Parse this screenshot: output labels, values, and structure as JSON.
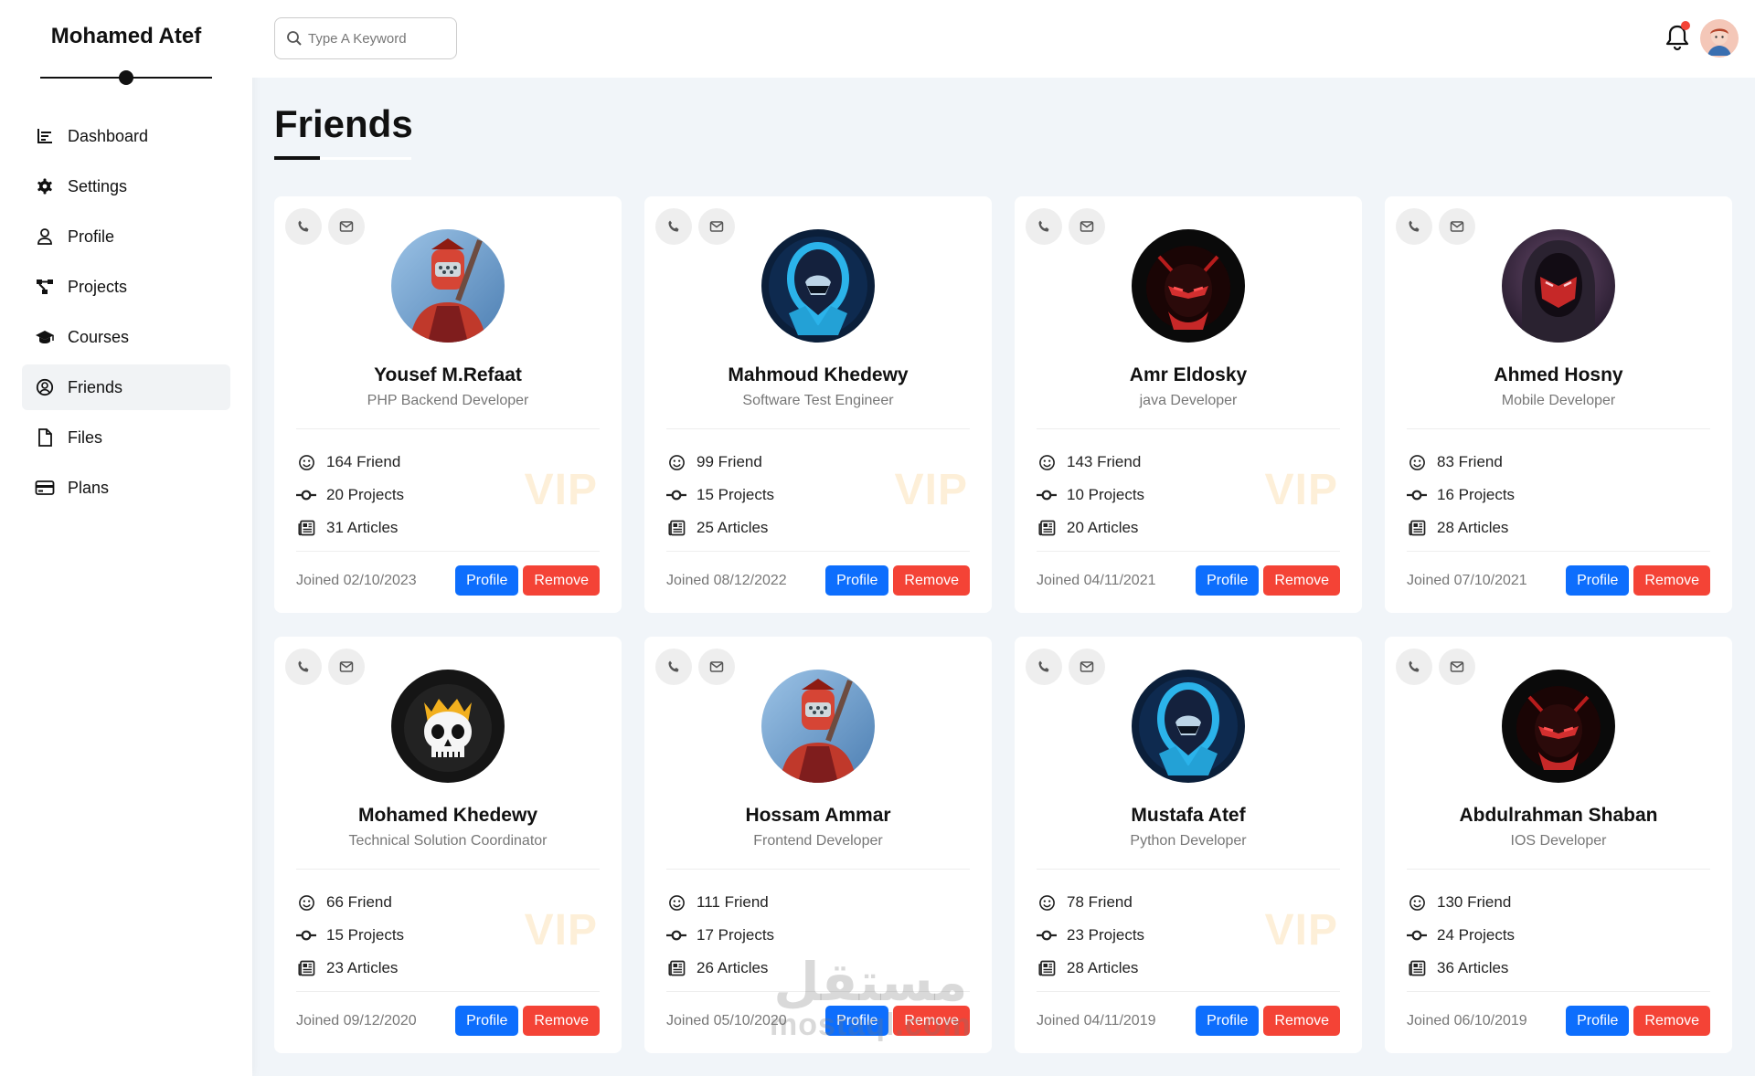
{
  "app": {
    "brand": "Mohamed Atef"
  },
  "sidebar": {
    "items": [
      {
        "label": "Dashboard",
        "icon": "chart-icon",
        "active": false
      },
      {
        "label": "Settings",
        "icon": "gear-icon",
        "active": false
      },
      {
        "label": "Profile",
        "icon": "user-icon",
        "active": false
      },
      {
        "label": "Projects",
        "icon": "project-diagram-icon",
        "active": false
      },
      {
        "label": "Courses",
        "icon": "graduation-cap-icon",
        "active": false
      },
      {
        "label": "Friends",
        "icon": "user-circle-icon",
        "active": true
      },
      {
        "label": "Files",
        "icon": "file-icon",
        "active": false
      },
      {
        "label": "Plans",
        "icon": "credit-card-icon",
        "active": false
      }
    ]
  },
  "header": {
    "search_placeholder": "Type A Keyword",
    "notification_badge_color": "#f44336"
  },
  "page": {
    "title": "Friends"
  },
  "labels": {
    "profile_button": "Profile",
    "remove_button": "Remove",
    "vip": "VIP"
  },
  "colors": {
    "primary": "#0d6efd",
    "danger": "#f44336",
    "vip": "#f59e0b"
  },
  "friends": [
    {
      "name": "Yousef M.Refaat",
      "role": "PHP Backend Developer",
      "friends": "164 Friend",
      "projects": "20 Projects",
      "articles": "31 Articles",
      "joined": "Joined 02/10/2023",
      "vip": true,
      "avatar": "red-armor-warrior"
    },
    {
      "name": "Mahmoud Khedewy",
      "role": "Software Test Engineer",
      "friends": "99 Friend",
      "projects": "15 Projects",
      "articles": "25 Articles",
      "joined": "Joined 08/12/2022",
      "vip": true,
      "avatar": "blue-hooded-assassin"
    },
    {
      "name": "Amr Eldosky",
      "role": "java Developer",
      "friends": "143 Friend",
      "projects": "10 Projects",
      "articles": "20 Articles",
      "joined": "Joined 04/11/2021",
      "vip": true,
      "avatar": "red-ninja"
    },
    {
      "name": "Ahmed Hosny",
      "role": "Mobile Developer",
      "friends": "83 Friend",
      "projects": "16 Projects",
      "articles": "28 Articles",
      "joined": "Joined 07/10/2021",
      "vip": false,
      "avatar": "red-masked-hood"
    },
    {
      "name": "Mohamed Khedewy",
      "role": "Technical Solution Coordinator",
      "friends": "66 Friend",
      "projects": "15 Projects",
      "articles": "23 Articles",
      "joined": "Joined 09/12/2020",
      "vip": true,
      "avatar": "crowned-skull"
    },
    {
      "name": "Hossam Ammar",
      "role": "Frontend Developer",
      "friends": "111 Friend",
      "projects": "17 Projects",
      "articles": "26 Articles",
      "joined": "Joined 05/10/2020",
      "vip": false,
      "avatar": "red-armor-warrior"
    },
    {
      "name": "Mustafa Atef",
      "role": "Python Developer",
      "friends": "78 Friend",
      "projects": "23 Projects",
      "articles": "28 Articles",
      "joined": "Joined 04/11/2019",
      "vip": true,
      "avatar": "blue-hooded-assassin"
    },
    {
      "name": "Abdulrahman Shaban",
      "role": "IOS Developer",
      "friends": "130 Friend",
      "projects": "24 Projects",
      "articles": "36 Articles",
      "joined": "Joined 06/10/2019",
      "vip": false,
      "avatar": "red-ninja"
    }
  ],
  "watermark": {
    "arabic": "مستقل",
    "latin": "mostaql.com"
  }
}
